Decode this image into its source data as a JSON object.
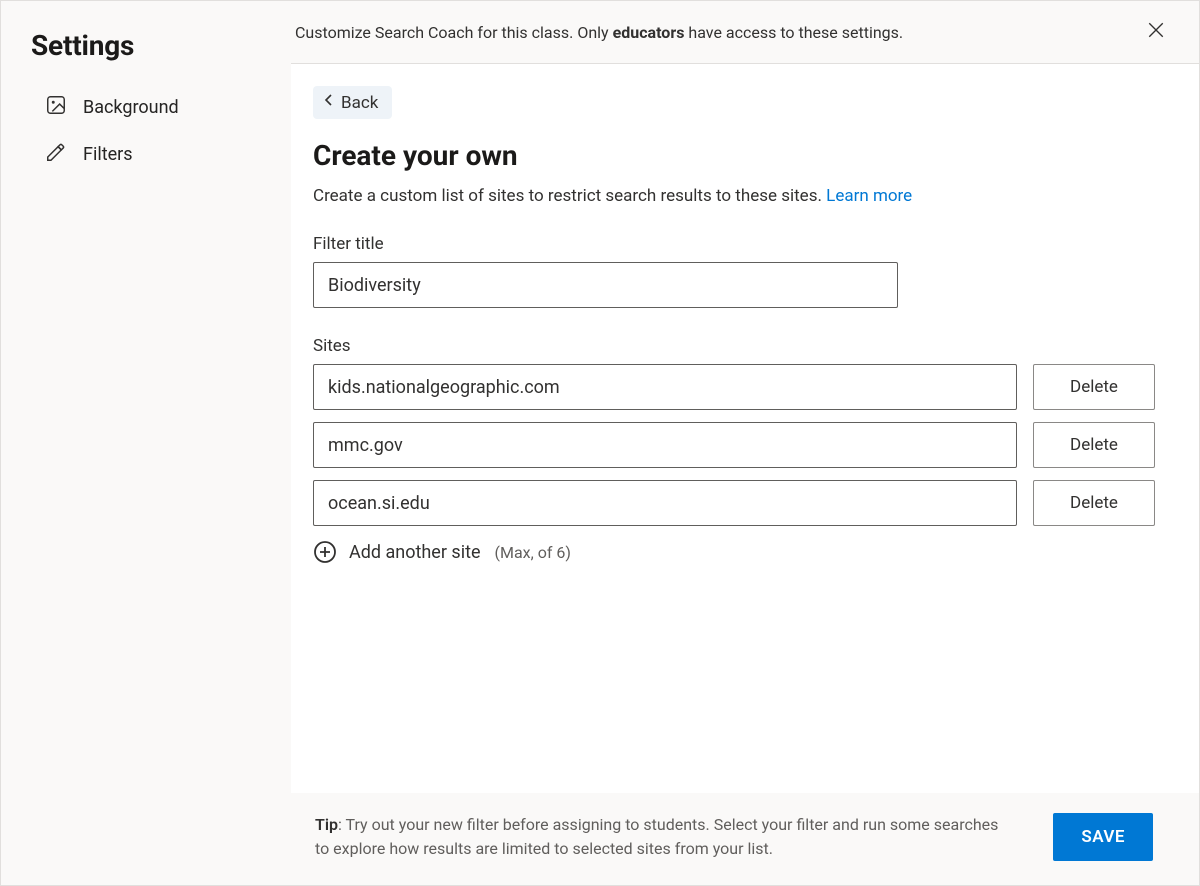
{
  "sidebar": {
    "title": "Settings",
    "items": [
      {
        "label": "Background",
        "name": "nav-background",
        "icon": "image-icon"
      },
      {
        "label": "Filters",
        "name": "nav-filters",
        "icon": "edit-icon"
      }
    ]
  },
  "topbar": {
    "text_before": "Customize Search Coach for this class. Only ",
    "text_bold": "educators",
    "text_after": " have access to these settings."
  },
  "panel": {
    "back_label": "Back",
    "heading": "Create your own",
    "description": "Create a custom list of sites to restrict search results to these sites. ",
    "learn_more": "Learn more",
    "filter_title_label": "Filter title",
    "filter_title_value": "Biodiversity",
    "sites_label": "Sites",
    "sites": [
      {
        "value": "kids.nationalgeographic.com"
      },
      {
        "value": "mmc.gov"
      },
      {
        "value": "ocean.si.edu"
      }
    ],
    "delete_label": "Delete",
    "add_label": "Add another site",
    "add_max": "(Max, of 6)"
  },
  "footer": {
    "tip_bold": "Tip",
    "tip_text": ": Try out your new filter before assigning to students. Select your filter and run some searches to explore how results are limited to selected sites from your list.",
    "save_label": "SAVE"
  }
}
